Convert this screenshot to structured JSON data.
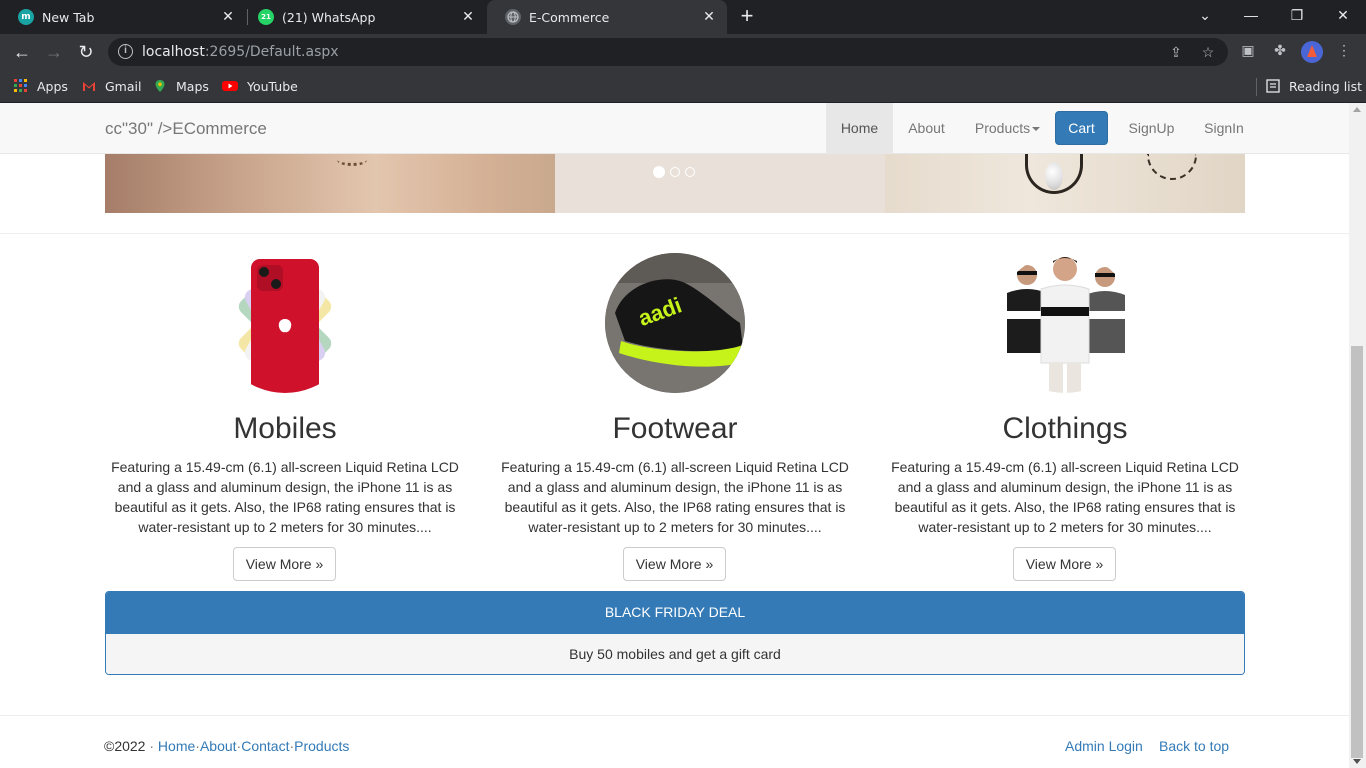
{
  "browser": {
    "tabs": [
      {
        "title": "New Tab",
        "favicon": "m",
        "favicon_color": "#1aa3a3"
      },
      {
        "title": "(21) WhatsApp",
        "favicon": "21",
        "favicon_color": "#25d366"
      },
      {
        "title": "E-Commerce",
        "favicon": "globe-icon",
        "favicon_color": "#9aa0a6"
      }
    ],
    "url_host": "localhost",
    "url_rest": ":2695/Default.aspx",
    "bookmarks": [
      {
        "label": "Apps"
      },
      {
        "label": "Gmail"
      },
      {
        "label": "Maps"
      },
      {
        "label": "YouTube"
      }
    ],
    "reading_list": "Reading list"
  },
  "site": {
    "brand": "cc\"30\" />ECommerce",
    "nav": {
      "home": "Home",
      "about": "About",
      "products": "Products",
      "cart": "Cart",
      "signup": "SignUp",
      "signin": "SignIn"
    },
    "carousel": {
      "slide_count": 3,
      "active_index": 0
    },
    "categories": [
      {
        "title": "Mobiles",
        "description": "Featuring a 15.49-cm (6.1) all-screen Liquid Retina LCD and a glass and aluminum design, the iPhone 11 is as beautiful as it gets. Also, the IP68 rating ensures that is water-resistant up to 2 meters for 30 minutes....",
        "button": "View More »"
      },
      {
        "title": "Footwear",
        "description": "Featuring a 15.49-cm (6.1) all-screen Liquid Retina LCD and a glass and aluminum design, the iPhone 11 is as beautiful as it gets. Also, the IP68 rating ensures that is water-resistant up to 2 meters for 30 minutes....",
        "button": "View More »"
      },
      {
        "title": "Clothings",
        "description": "Featuring a 15.49-cm (6.1) all-screen Liquid Retina LCD and a glass and aluminum design, the iPhone 11 is as beautiful as it gets. Also, the IP68 rating ensures that is water-resistant up to 2 meters for 30 minutes....",
        "button": "View More »"
      }
    ],
    "deal": {
      "heading": "BLACK FRIDAY DEAL",
      "body": "Buy 50 mobiles and get a gift card"
    },
    "footer": {
      "copyright": "©2022",
      "sep": "·",
      "links": [
        "Home",
        "About",
        "Contact",
        "Products"
      ],
      "admin_login": "Admin Login",
      "back_to_top": "Back to top"
    },
    "colors": {
      "primary": "#337ab7",
      "navbar_bg": "#f8f8f8"
    }
  }
}
